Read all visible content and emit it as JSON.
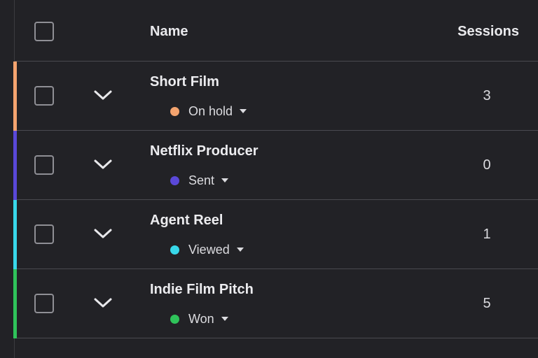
{
  "header": {
    "name_label": "Name",
    "sessions_label": "Sessions"
  },
  "rows": [
    {
      "title": "Short Film",
      "status": "On hold",
      "status_color": "#f4a46f",
      "accent_color": "#f4a46f",
      "sessions": "3"
    },
    {
      "title": "Netflix Producer",
      "status": "Sent",
      "status_color": "#5a48d8",
      "accent_color": "#5a48d8",
      "sessions": "0"
    },
    {
      "title": "Agent Reel",
      "status": "Viewed",
      "status_color": "#38d8ea",
      "accent_color": "#38d8ea",
      "sessions": "1"
    },
    {
      "title": "Indie Film Pitch",
      "status": "Won",
      "status_color": "#2fc35a",
      "accent_color": "#2fc35a",
      "sessions": "5"
    }
  ],
  "icons": {
    "select_all": "checkbox-icon",
    "row_select": "checkbox-icon",
    "expand": "chevron-down-icon",
    "status_dropdown": "caret-down-icon"
  }
}
